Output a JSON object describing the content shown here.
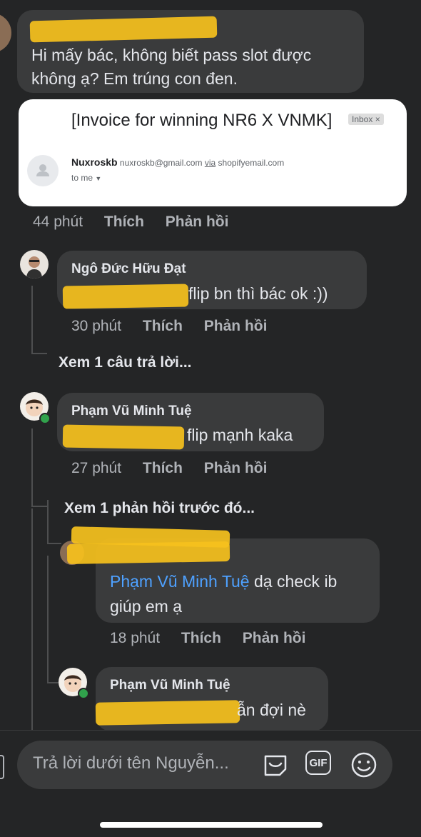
{
  "main_comment": {
    "text_line1": "Hi mấy bác, không biết pass slot được",
    "text_line2": "không ạ? Em trúng con đen.",
    "time": "44 phút",
    "like": "Thích",
    "reply": "Phản hồi"
  },
  "email": {
    "subject": "[Invoice for winning NR6 X VNMK]",
    "label": "Inbox",
    "sender_name": "Nuxroskb",
    "sender_email": "nuxroskb@gmail.com",
    "via": "via",
    "via_domain": "shopifyemail.com",
    "to": "to me"
  },
  "reply1": {
    "name": "Ngô Đức Hữu Đạt",
    "text": "flip bn thì bác ok :))",
    "time": "30 phút",
    "like": "Thích",
    "reply": "Phản hồi",
    "more": "Xem 1 câu trả lời..."
  },
  "reply2": {
    "name": "Phạm Vũ Minh Tuệ",
    "text": "flip mạnh kaka",
    "time": "27 phút",
    "like": "Thích",
    "reply": "Phản hồi",
    "more": "Xem 1 phản hồi trước đó..."
  },
  "reply3": {
    "mention": "Phạm Vũ Minh Tuệ",
    "text1": "dạ check ib",
    "text2": "giúp em ạ",
    "time": "18 phút",
    "like": "Thích",
    "reply": "Phản hồi"
  },
  "reply4": {
    "name": "Phạm Vũ Minh Tuệ",
    "text": "ẫn đợi nè"
  },
  "composer": {
    "placeholder": "Trả lời dưới tên Nguyễn...",
    "gif": "GIF"
  },
  "colors": {
    "background": "#242526",
    "bubble": "#3a3b3c",
    "mention": "#4ea1ff",
    "highlight": "#f6c11d",
    "online": "#31a24c"
  }
}
